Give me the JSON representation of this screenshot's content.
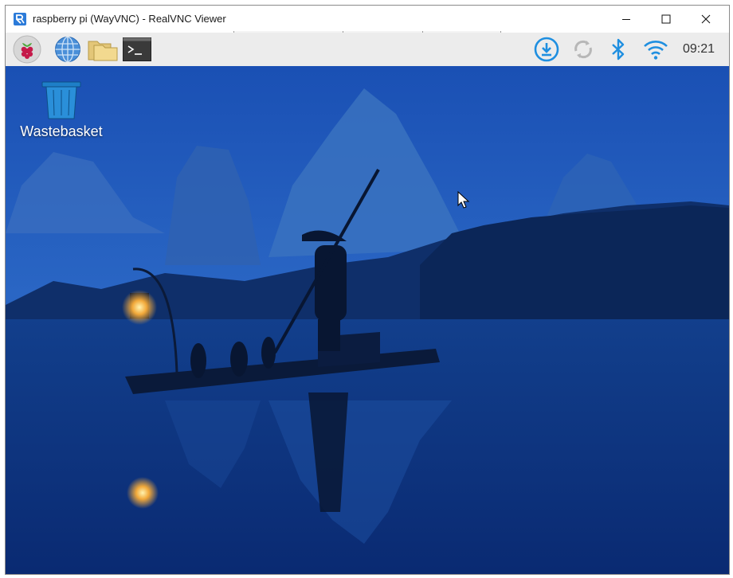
{
  "window": {
    "title": "raspberry pi (WayVNC) - RealVNC Viewer",
    "app_icon": "realvnc-icon",
    "controls": [
      "minimize-icon",
      "maximize-icon",
      "close-icon"
    ]
  },
  "taskbar": {
    "launchers": [
      "raspberry-menu-icon",
      "web-browser-icon",
      "file-manager-icon",
      "terminal-icon"
    ],
    "tray": [
      "download-update-icon",
      "sync-icon",
      "bluetooth-icon",
      "wifi-icon"
    ],
    "clock": "09:21",
    "accent": "#1f8fe0"
  },
  "desktop": {
    "icons": [
      {
        "label": "Wastebasket",
        "icon": "trash-icon"
      }
    ],
    "wallpaper": "blue dusk river scene with karst mountains and boatman",
    "colors": {
      "sky": "#1a53b8",
      "water": "#0b2f7a"
    }
  }
}
